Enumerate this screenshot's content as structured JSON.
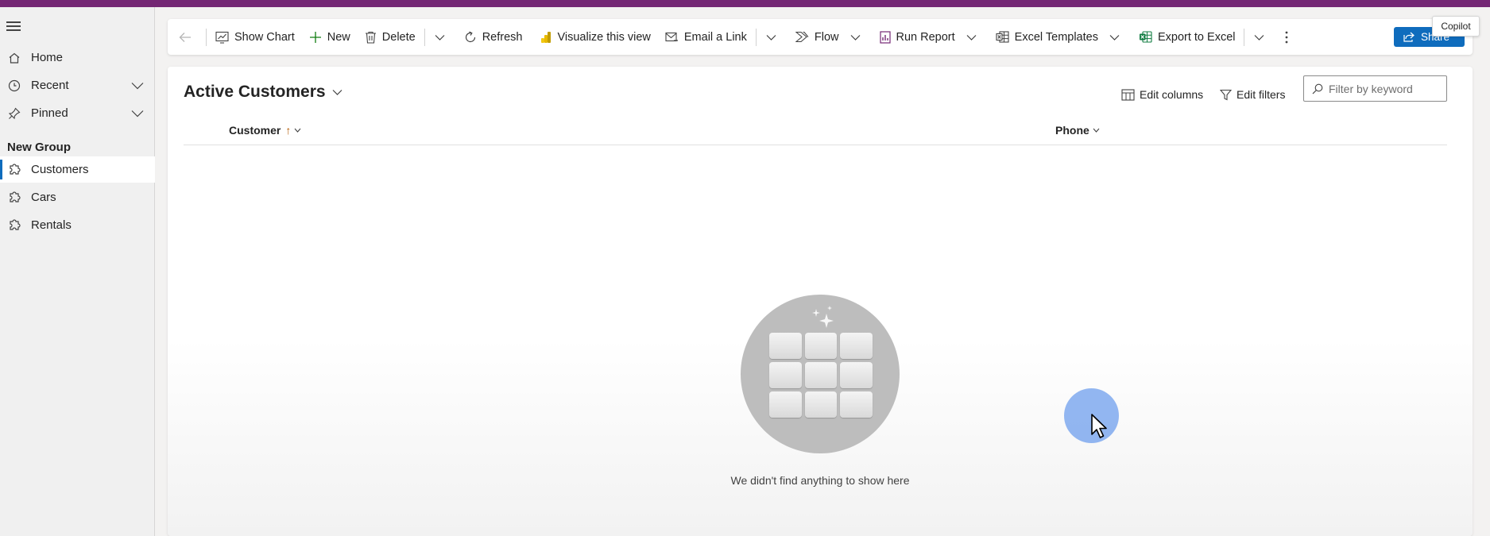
{
  "sidebar": {
    "items": [
      {
        "label": "Home"
      },
      {
        "label": "Recent"
      },
      {
        "label": "Pinned"
      }
    ],
    "group_title": "New Group",
    "group_items": [
      {
        "label": "Customers"
      },
      {
        "label": "Cars"
      },
      {
        "label": "Rentals"
      }
    ],
    "selected": "Customers"
  },
  "commandbar": {
    "show_chart": "Show Chart",
    "new": "New",
    "delete": "Delete",
    "refresh": "Refresh",
    "visualize": "Visualize this view",
    "email_link": "Email a Link",
    "flow": "Flow",
    "run_report": "Run Report",
    "excel_templates": "Excel Templates",
    "export_excel": "Export to Excel",
    "share": "Share",
    "copilot_tooltip": "Copilot"
  },
  "view": {
    "title": "Active Customers",
    "edit_columns": "Edit columns",
    "edit_filters": "Edit filters",
    "filter_placeholder": "Filter by keyword",
    "columns": [
      {
        "label": "Customer",
        "sorted": "ascending"
      },
      {
        "label": "Phone"
      }
    ],
    "empty_message": "We didn't find anything to show here"
  },
  "colors": {
    "brand_bar": "#742774",
    "accent": "#0f6cbd"
  }
}
